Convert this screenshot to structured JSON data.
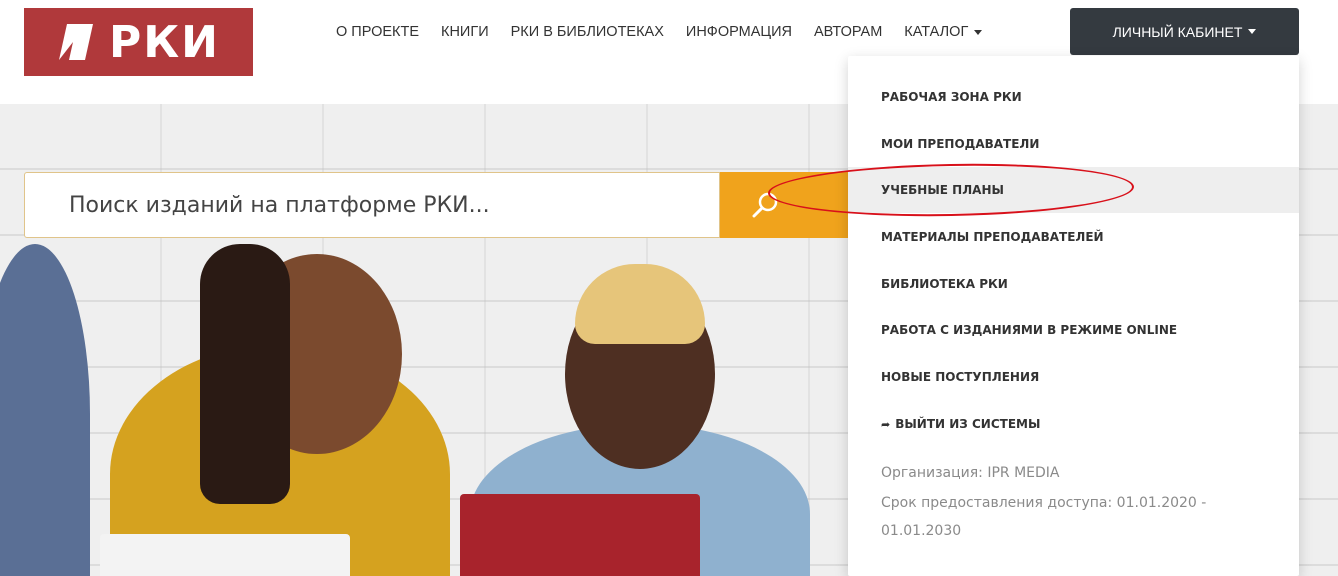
{
  "logo": {
    "text": "РКИ"
  },
  "nav": {
    "items": [
      "О ПРОЕКТЕ",
      "КНИГИ",
      "РКИ В БИБЛИОТЕКАХ",
      "ИНФОРМАЦИЯ",
      "АВТОРАМ"
    ],
    "catalog_label": "КАТАЛОГ"
  },
  "cabinet": {
    "label": "ЛИЧНЫЙ КАБИНЕТ"
  },
  "search": {
    "placeholder": "Поиск изданий на платформе РКИ..."
  },
  "dropdown": {
    "items": [
      "РАБОЧАЯ ЗОНА РКИ",
      "МОИ ПРЕПОДАВАТЕЛИ",
      "УЧЕБНЫЕ ПЛАНЫ",
      "МАТЕРИАЛЫ ПРЕПОДАВАТЕЛЕЙ",
      "БИБЛИОТЕКА РКИ",
      "РАБОТА С ИЗДАНИЯМИ В РЕЖИМЕ ONLINE",
      "НОВЫЕ ПОСТУПЛЕНИЯ"
    ],
    "logout_label": "ВЫЙТИ ИЗ СИСТЕМЫ",
    "organization": "Организация: IPR MEDIA",
    "access_line1": "Срок предоставления доступа: 01.01.2020 -",
    "access_line2": "01.01.2030"
  },
  "colors": {
    "brand": "#b0393b",
    "search_button": "#f0a31c",
    "cabinet_button": "#343a40",
    "annotation": "#d8101a"
  },
  "icons": {
    "logo": "logo-mark-icon",
    "search": "search-icon",
    "logout": "logout-icon"
  }
}
